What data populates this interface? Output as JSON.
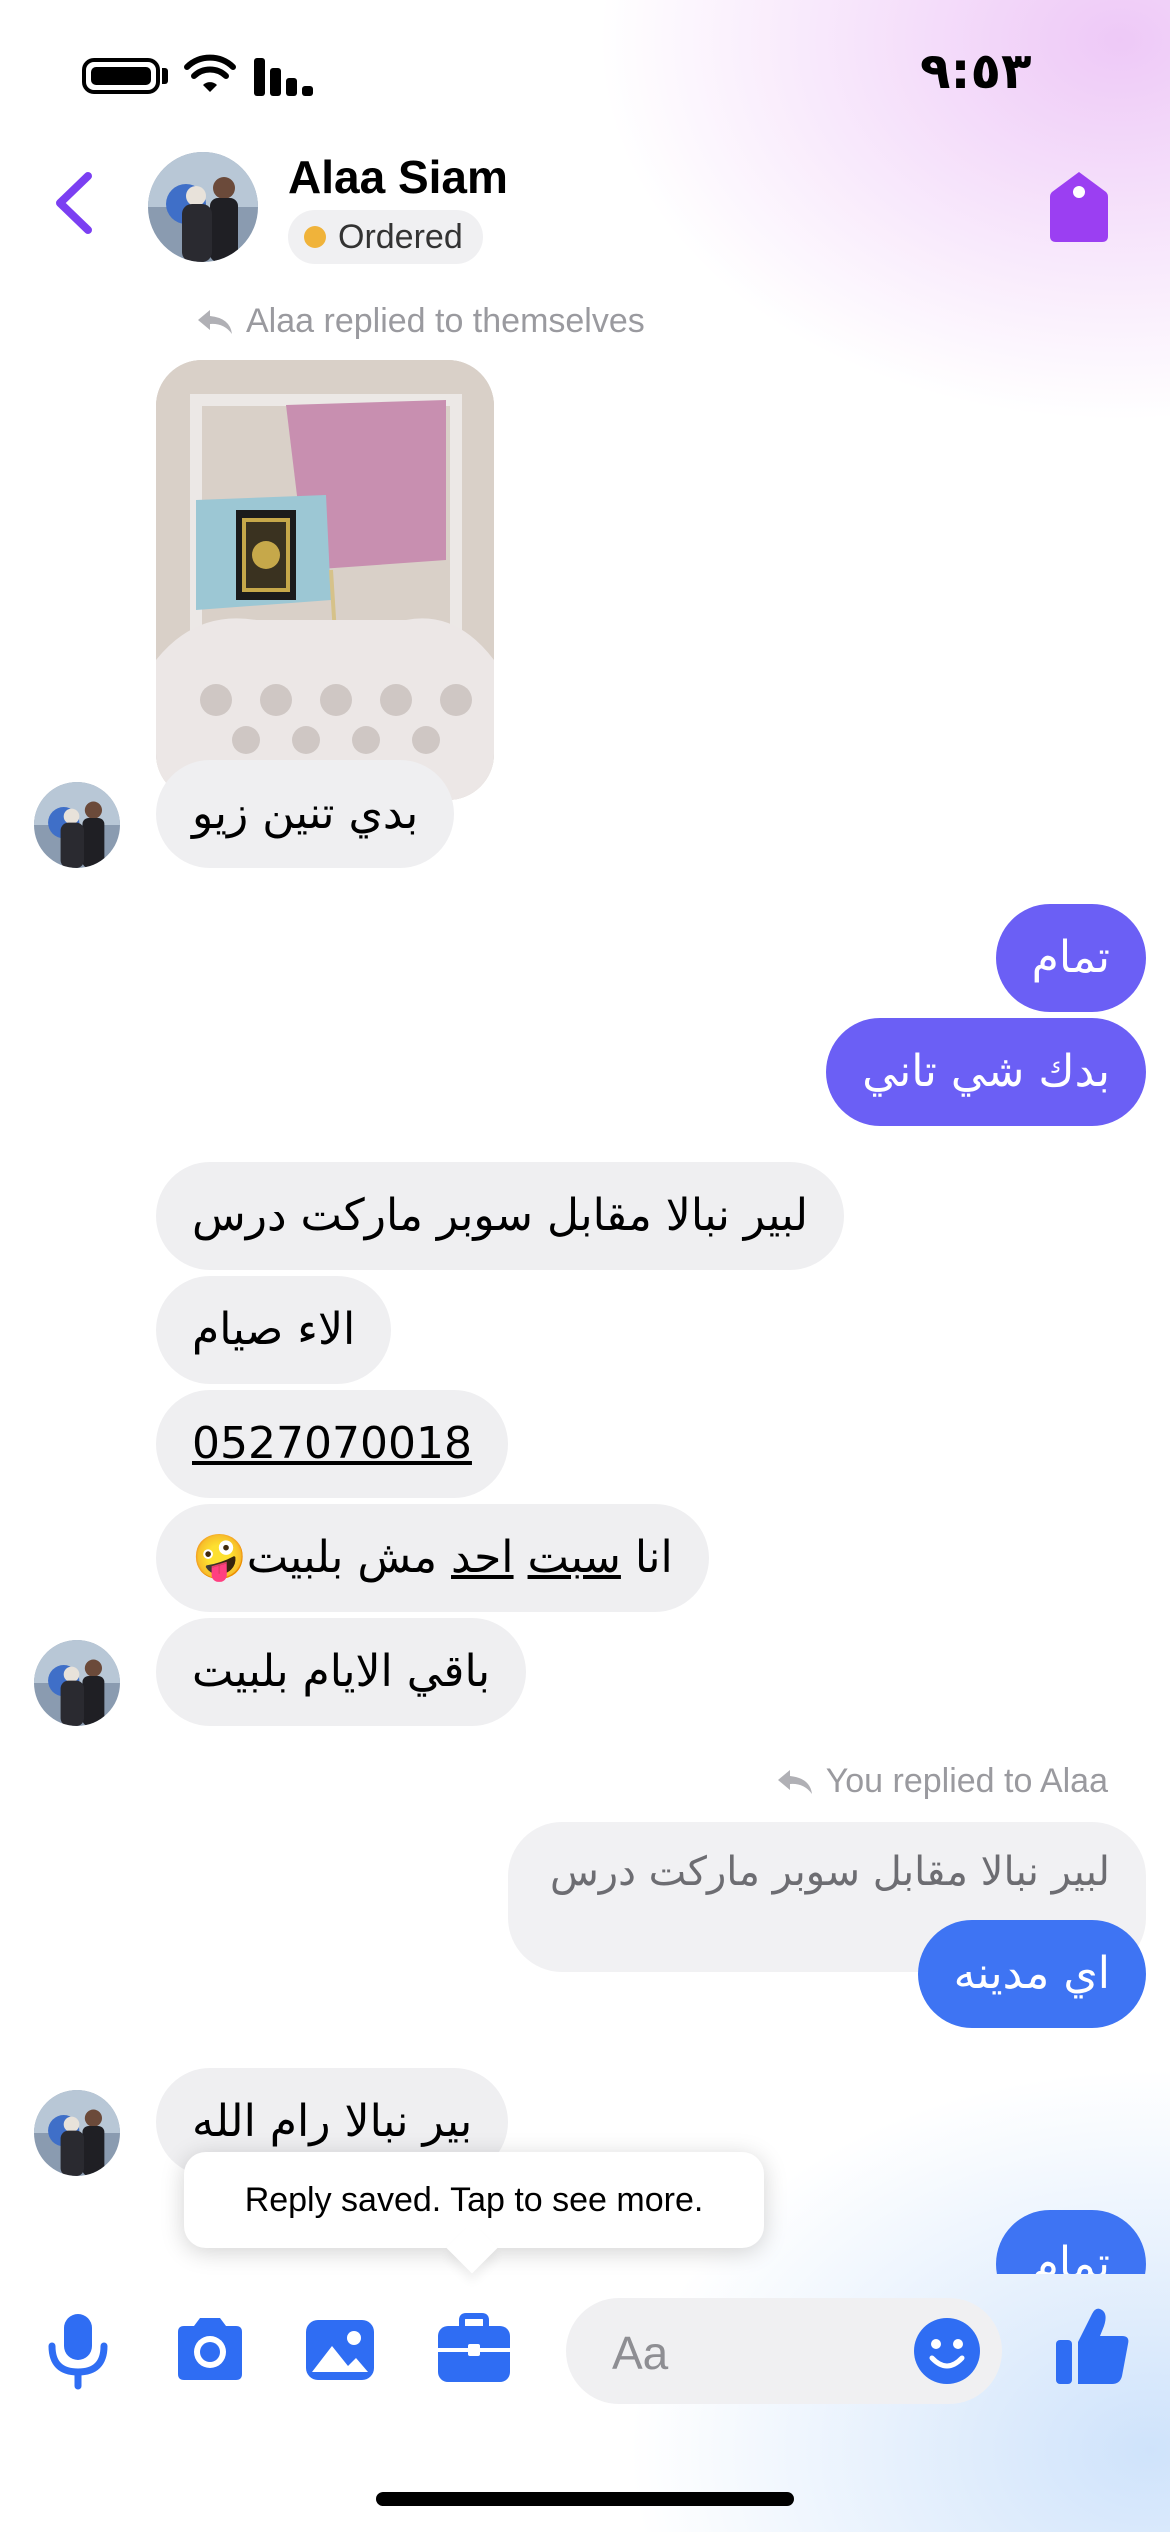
{
  "status_bar": {
    "time": "٩:٥٣"
  },
  "header": {
    "contact_name": "Alaa Siam",
    "status_label": "Ordered",
    "colors": {
      "accent": "#7b3ff2",
      "status_dot": "#f0b33a"
    }
  },
  "messages": {
    "reply_meta_1": "Alaa replied to themselves",
    "caption_1": "بدي تنين زيو",
    "out_1": "تمام",
    "out_2": "بدك شي تاني",
    "in_1": "لبير نبالا مقابل سوبر ماركت درس",
    "in_2": "الاء صيام",
    "in_3": "0527070018",
    "in_4_a": "انا ",
    "in_4_b": "سبت",
    "in_4_c": " ",
    "in_4_d": "احد",
    "in_4_e": " مش بلبيت",
    "in_4_emoji": "🤪",
    "in_5": "باقي الايام بلبيت",
    "reply_meta_2": "You replied to Alaa",
    "quoted_text": "لبير نبالا مقابل سوبر ماركت درس",
    "out_3": "اي مدينه",
    "in_6": "بير نبالا رام الله",
    "out_4": "تمام"
  },
  "tooltip": {
    "text": "Reply saved. Tap to see more."
  },
  "composer": {
    "placeholder": "Aa"
  },
  "colors": {
    "bubble_purple": "#6b5ff5",
    "bubble_blue": "#3e74f3",
    "icon_blue": "#2f6df3"
  }
}
